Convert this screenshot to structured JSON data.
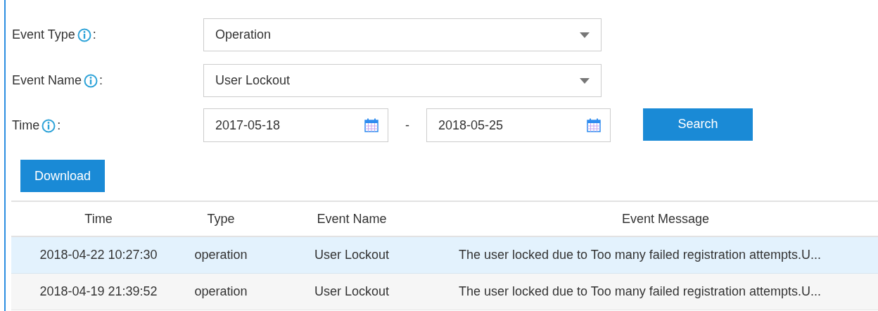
{
  "filters": [
    {
      "label": "Event Type",
      "colon": ":",
      "value": "Operation"
    },
    {
      "label": "Event Name",
      "colon": ":",
      "value": "User Lockout"
    }
  ],
  "time": {
    "label": "Time",
    "colon": ":",
    "start": "2017-05-18",
    "separator": "-",
    "end": "2018-05-25"
  },
  "search_button": "Search",
  "download_button": "Download",
  "table": {
    "columns": [
      "Time",
      "Type",
      "Event Name",
      "Event Message"
    ],
    "rows": [
      {
        "cells": [
          "2018-04-22 10:27:30",
          "operation",
          "User Lockout",
          "The user locked due to Too many failed registration attempts.U..."
        ],
        "selected": true
      },
      {
        "cells": [
          "2018-04-19 21:39:52",
          "operation",
          "User Lockout",
          "The user locked due to Too many failed registration attempts.U..."
        ],
        "selected": false
      }
    ]
  }
}
